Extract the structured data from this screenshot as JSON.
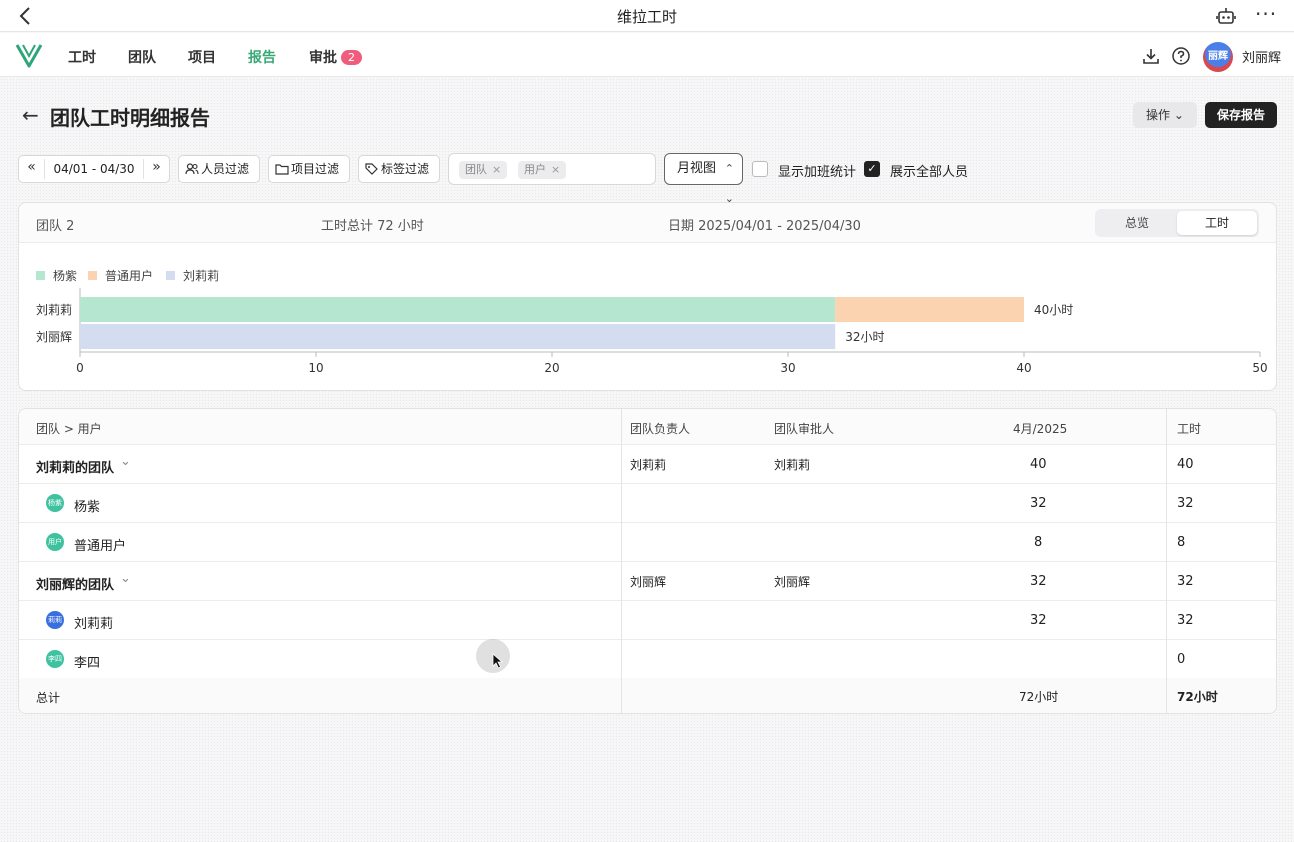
{
  "titlebar": {
    "title": "维拉工时"
  },
  "nav": {
    "items": [
      "工时",
      "团队",
      "项目",
      "报告",
      "审批"
    ],
    "approval_count": "2",
    "username": "刘丽辉",
    "avatar_text": "丽辉"
  },
  "page": {
    "title": "团队工时明细报告",
    "ops_label": "操作",
    "save_label": "保存报告"
  },
  "filters": {
    "date_range": "04/01 - 04/30",
    "people_filter": "人员过滤",
    "project_filter": "项目过滤",
    "tag_filter": "标签过滤",
    "chips": [
      "团队",
      "用户"
    ],
    "view": "月视图",
    "show_overtime": "显示加班统计",
    "show_all_people": "展示全部人员",
    "show_overtime_checked": false,
    "show_all_checked": true
  },
  "summary": {
    "team": "团队 2",
    "total": "工时总计 72 小时",
    "date": "日期 2025/04/01 - 2025/04/30",
    "tab_overview": "总览",
    "tab_hours": "工时"
  },
  "chart_data": {
    "type": "bar",
    "orientation": "horizontal",
    "stacked": true,
    "categories": [
      "刘莉莉",
      "刘丽辉"
    ],
    "series": [
      {
        "name": "杨紫",
        "color": "#b5e6cf",
        "values": [
          32,
          0
        ]
      },
      {
        "name": "普通用户",
        "color": "#fbd3b0",
        "values": [
          8,
          0
        ]
      },
      {
        "name": "刘莉莉",
        "color": "#d4dcf0",
        "values": [
          0,
          32
        ]
      }
    ],
    "bar_labels": [
      "40小时",
      "32小时"
    ],
    "xlim": [
      0,
      50
    ],
    "xticks": [
      0,
      10,
      20,
      30,
      40,
      50
    ],
    "legend_position": "top-left"
  },
  "table": {
    "headers": {
      "team_user": "团队 > 用户",
      "leader": "团队负责人",
      "approver": "团队审批人",
      "month": "4月/2025",
      "hours": "工时"
    },
    "rows": [
      {
        "kind": "team",
        "name": "刘莉莉的团队",
        "leader": "刘莉莉",
        "approver": "刘莉莉",
        "month": "40",
        "hours": "40"
      },
      {
        "kind": "user",
        "name": "杨紫",
        "avatar": "杨紫",
        "avatar_color": "#3ec2a0",
        "leader": "",
        "approver": "",
        "month": "32",
        "hours": "32"
      },
      {
        "kind": "user",
        "name": "普通用户",
        "avatar": "用户",
        "avatar_color": "#3ec2a0",
        "leader": "",
        "approver": "",
        "month": "8",
        "hours": "8"
      },
      {
        "kind": "team",
        "name": "刘丽辉的团队",
        "leader": "刘丽辉",
        "approver": "刘丽辉",
        "month": "32",
        "hours": "32"
      },
      {
        "kind": "user",
        "name": "刘莉莉",
        "avatar": "莉莉",
        "avatar_color": "#3a6fe0",
        "leader": "",
        "approver": "",
        "month": "32",
        "hours": "32"
      },
      {
        "kind": "user",
        "name": "李四",
        "avatar": "李四",
        "avatar_color": "#3ec2a0",
        "leader": "",
        "approver": "",
        "month": "",
        "hours": "0"
      }
    ],
    "total": {
      "label": "总计",
      "month": "72小时",
      "hours": "72小时"
    }
  }
}
